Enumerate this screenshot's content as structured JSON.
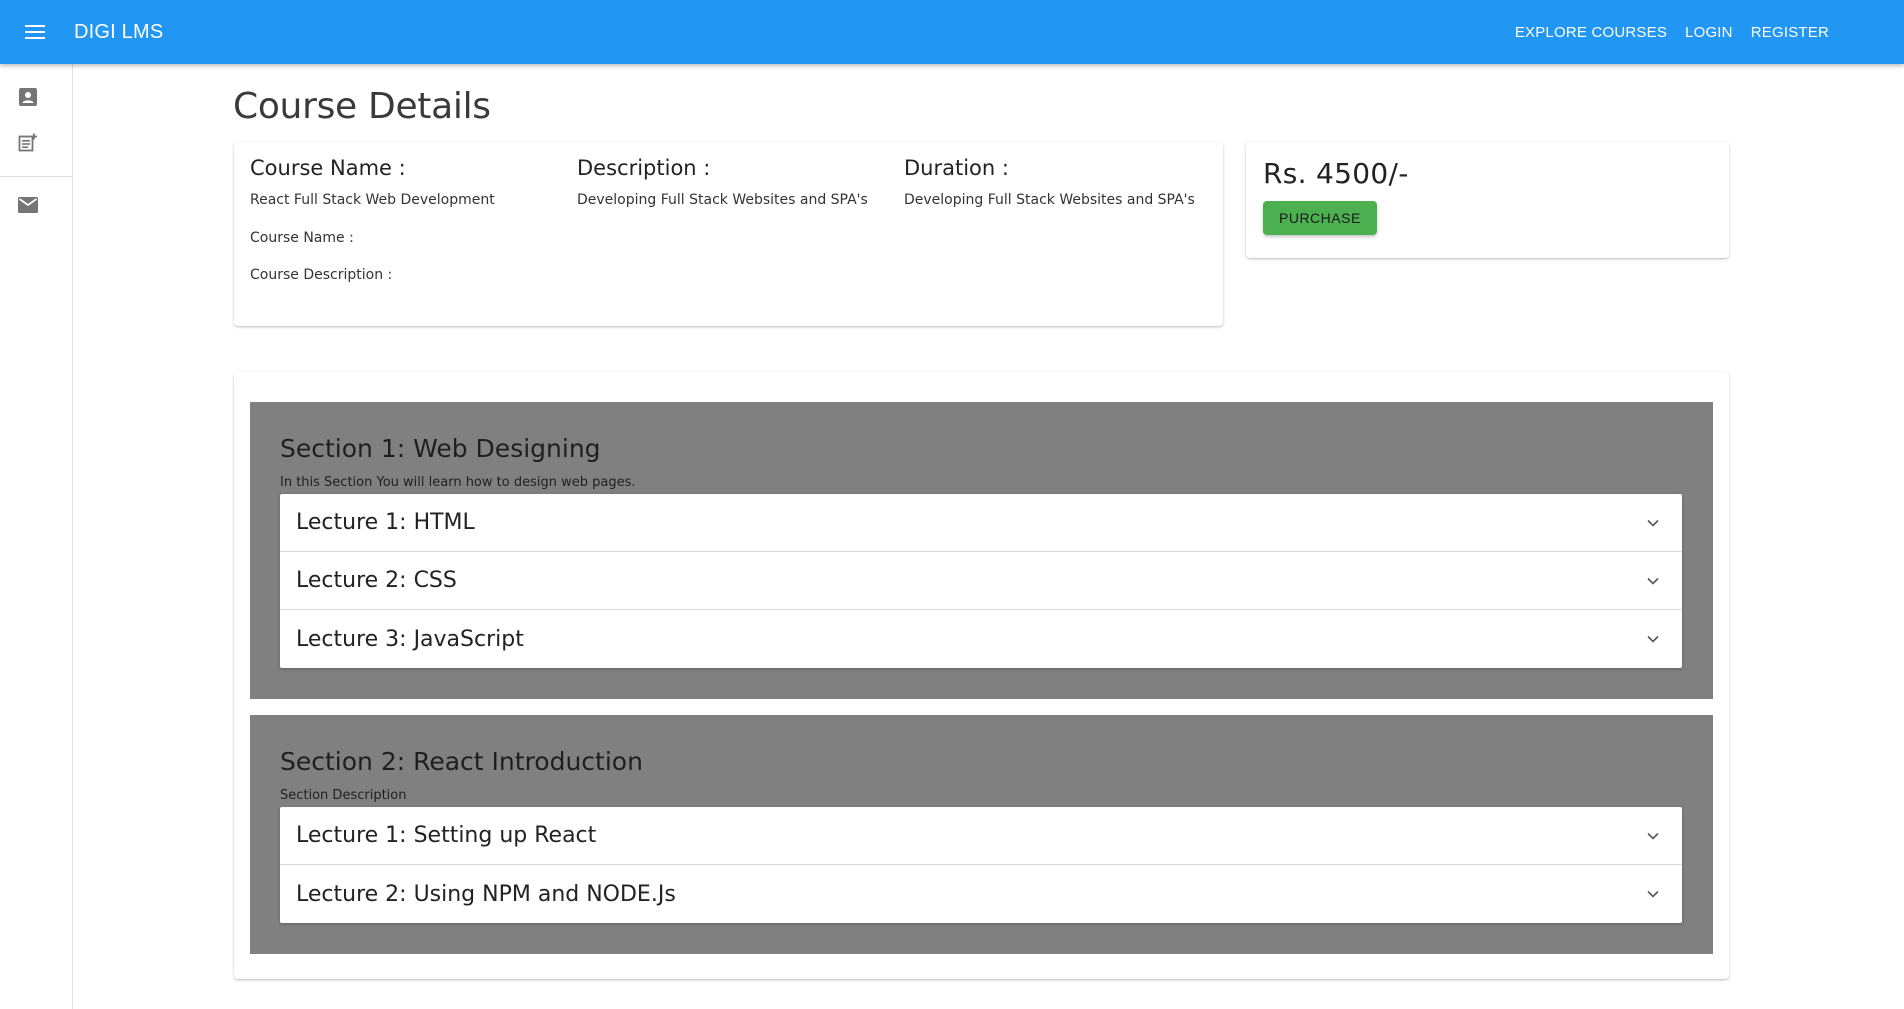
{
  "header": {
    "brand": "DIGI LMS",
    "nav": [
      "EXPLORE COURSES",
      "LOGIN",
      "REGISTER"
    ]
  },
  "drawer": {
    "icons": [
      "account-box-icon",
      "post-add-icon",
      "mail-icon"
    ]
  },
  "page": {
    "title": "Course Details"
  },
  "course": {
    "name_label": "Course Name :",
    "name_value": "React Full Stack Web Development",
    "description_label": "Description :",
    "description_value": "Developing Full Stack Websites and SPA's",
    "duration_label": "Duration :",
    "duration_value": "Developing Full Stack Websites and SPA's",
    "extra_name_label": "Course Name :",
    "extra_description_label": "Course Description :"
  },
  "pricing": {
    "price": "Rs. 4500/-",
    "purchase_label": "PURCHASE",
    "accent": "#4caf50"
  },
  "sections": [
    {
      "title": "Section 1: Web Designing",
      "description": "In this Section You will learn how to design web pages.",
      "lectures": [
        "Lecture 1: HTML",
        "Lecture 2: CSS",
        "Lecture 3: JavaScript"
      ]
    },
    {
      "title": "Section 2: React Introduction",
      "description": "Section Description",
      "lectures": [
        "Lecture 1: Setting up React",
        "Lecture 2: Using NPM and NODE.Js"
      ]
    }
  ],
  "colors": {
    "appbar": "#2196f3",
    "section_bg": "#808080"
  }
}
